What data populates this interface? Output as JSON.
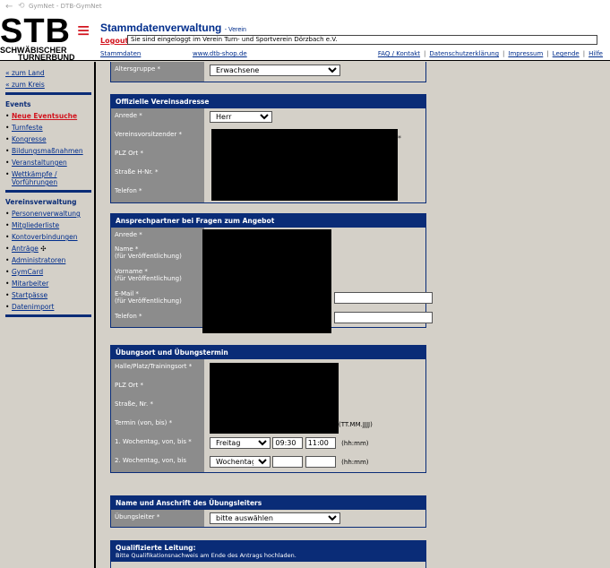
{
  "window": {
    "title": "GymNet - DTB-GymNet",
    "back_icon": "arrow-left",
    "reload_icon": "reload"
  },
  "header": {
    "logo": {
      "mark": "STB",
      "line1": "SCHWÄBISCHER",
      "line2": "TURNERBUND"
    },
    "title": "Stammdatenverwaltung",
    "subtitle": "- Verein",
    "logout": "Logout",
    "message": "Sie sind eingeloggt im Verein Turn- und Sportverein Dörzbach e.V.",
    "nav_left": "Stammdaten",
    "nav_mid": "www.dtb-shop.de",
    "nav_right": [
      "FAQ / Kontakt",
      "Datenschutzerklärung",
      "Impressum",
      "Legende",
      "Hilfe"
    ]
  },
  "sidebar": {
    "top_links": [
      "« zum Land",
      "« zum Kreis"
    ],
    "events_title": "Events",
    "events": [
      "Neue Eventsuche",
      "Turnfeste",
      "Kongresse",
      "Bildungsmaßnahmen",
      "Veranstaltungen",
      "Wettkämpfe / Vorführungen"
    ],
    "verein_title": "Vereinsverwaltung",
    "verein": [
      "Personenverwaltung",
      "Mitgliederliste",
      "Kontoverbindungen",
      "Anträge",
      "Administratoren",
      "GymCard",
      "Mitarbeiter",
      "Startpässe",
      "Datenimport"
    ]
  },
  "top_row": {
    "label": "Altersgruppe *",
    "value": "Erwachsene"
  },
  "adresse": {
    "title": "Offizielle Vereinsadresse",
    "labels": [
      "Anrede *",
      "Vereinsvorsitzender *",
      "PLZ Ort *",
      "Straße H-Nr. *",
      "Telefon *"
    ],
    "anrede_value": "Herr"
  },
  "ansprech": {
    "title": "Ansprechpartner bei Fragen zum Angebot",
    "labels": [
      "Anrede *",
      "Name *\n(für Veröffentlichung)",
      "Vorname *\n(für Veröffentlichung)",
      "E-Mail *\n(für Veröffentlichung)",
      "Telefon *"
    ]
  },
  "uebung": {
    "title": "Übungsort und Übungstermin",
    "labels": [
      "Halle/Platz/Trainingsort *",
      "PLZ Ort *",
      "Straße, Nr. *",
      "Termin (von, bis) *",
      "1. Wochentag, von, bis *",
      "2. Wochentag, von, bis"
    ],
    "termin_hint": "(TT.MM.JJJJ)",
    "day1": "Freitag",
    "from1": "09:30",
    "to1": "11:00",
    "time_hint": "(hh:mm)",
    "day2": "Wochentag"
  },
  "leiter": {
    "title": "Name und Anschrift des Übungsleiters",
    "label": "Übungsleiter *",
    "value": "bitte auswählen"
  },
  "qualifiziert": {
    "title": "Qualifizierte Leitung:",
    "note": "Bitte Qualifikationsnachweis am Ende des Antrags hochladen."
  }
}
